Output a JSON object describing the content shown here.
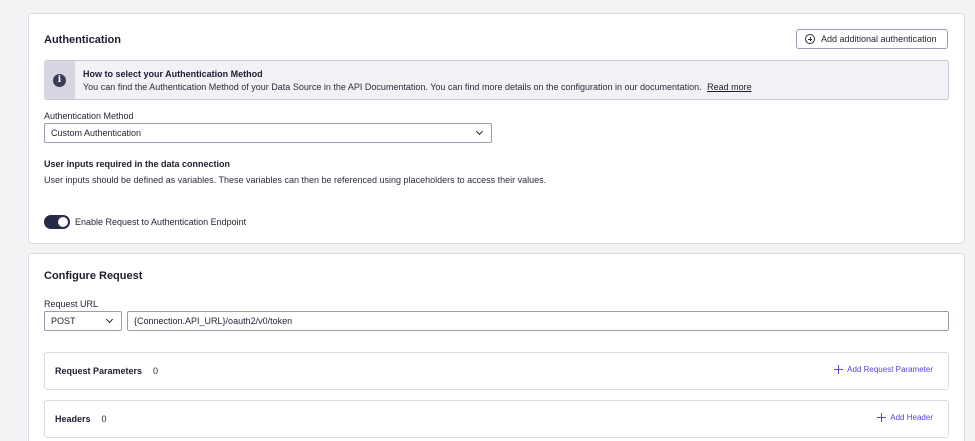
{
  "authentication": {
    "title": "Authentication",
    "add_button_label": "Add additional authentication",
    "info": {
      "title": "How to select your Authentication Method",
      "body": "You can find the Authentication Method of your Data Source in the API Documentation. You can find more details on the configuration in our documentation.",
      "link": "Read more"
    },
    "method_label": "Authentication Method",
    "method_value": "Custom Authentication",
    "user_inputs_title": "User inputs required in the data connection",
    "user_inputs_body": "User inputs should be defined as variables. These variables can then be referenced using placeholders to access their values.",
    "toggle_label": "Enable Request to Authentication Endpoint",
    "toggle_on": true
  },
  "configure_request": {
    "title": "Configure Request",
    "url_label": "Request URL",
    "method_value": "POST",
    "url_value": "{Connection.API_URL}/oauth2/v0/token",
    "panels": [
      {
        "title": "Request Parameters",
        "count": "0",
        "action": "Add Request Parameter"
      },
      {
        "title": "Headers",
        "count": "0",
        "action": "Add Header"
      }
    ]
  },
  "colors": {
    "accent": "#5b3fd9",
    "toggle": "#262a46",
    "border": "#dcdde3"
  }
}
